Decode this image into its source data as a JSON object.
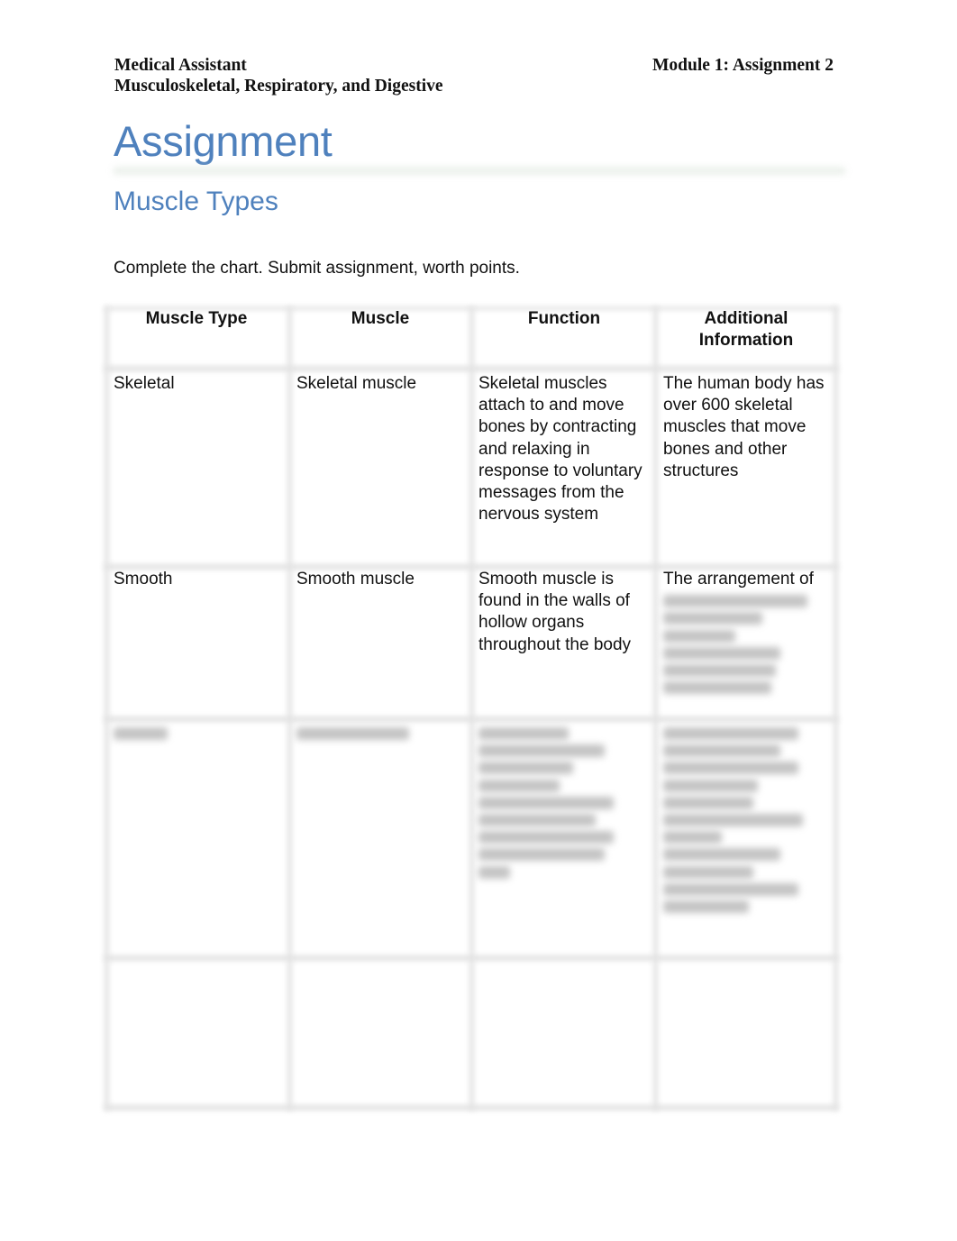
{
  "header": {
    "course": "Medical Assistant",
    "unit": "Musculoskeletal, Respiratory, and Digestive",
    "module": "Module 1: Assignment 2"
  },
  "title": "Assignment",
  "subtitle": "Muscle Types",
  "instruction": "Complete the chart. Submit assignment, worth points.",
  "table": {
    "headers": [
      "Muscle Type",
      "Muscle",
      "Function",
      "Additional Information"
    ],
    "rows": [
      {
        "type": "Skeletal",
        "muscle": "Skeletal muscle",
        "function": "Skeletal muscles attach to and move bones by contracting and relaxing in response to voluntary messages from the nervous system",
        "info": "The human body has over 600 skeletal muscles that move bones and other structures"
      },
      {
        "type": "Smooth",
        "muscle": "Smooth muscle",
        "function": "Smooth muscle is found in the walls of hollow organs throughout the body",
        "info": "The arrangement of",
        "info_blurred": true
      },
      {
        "type": "",
        "muscle": "",
        "function": "",
        "info": "",
        "blurred": true
      },
      {
        "type": "",
        "muscle": "",
        "function": "",
        "info": ""
      }
    ]
  }
}
